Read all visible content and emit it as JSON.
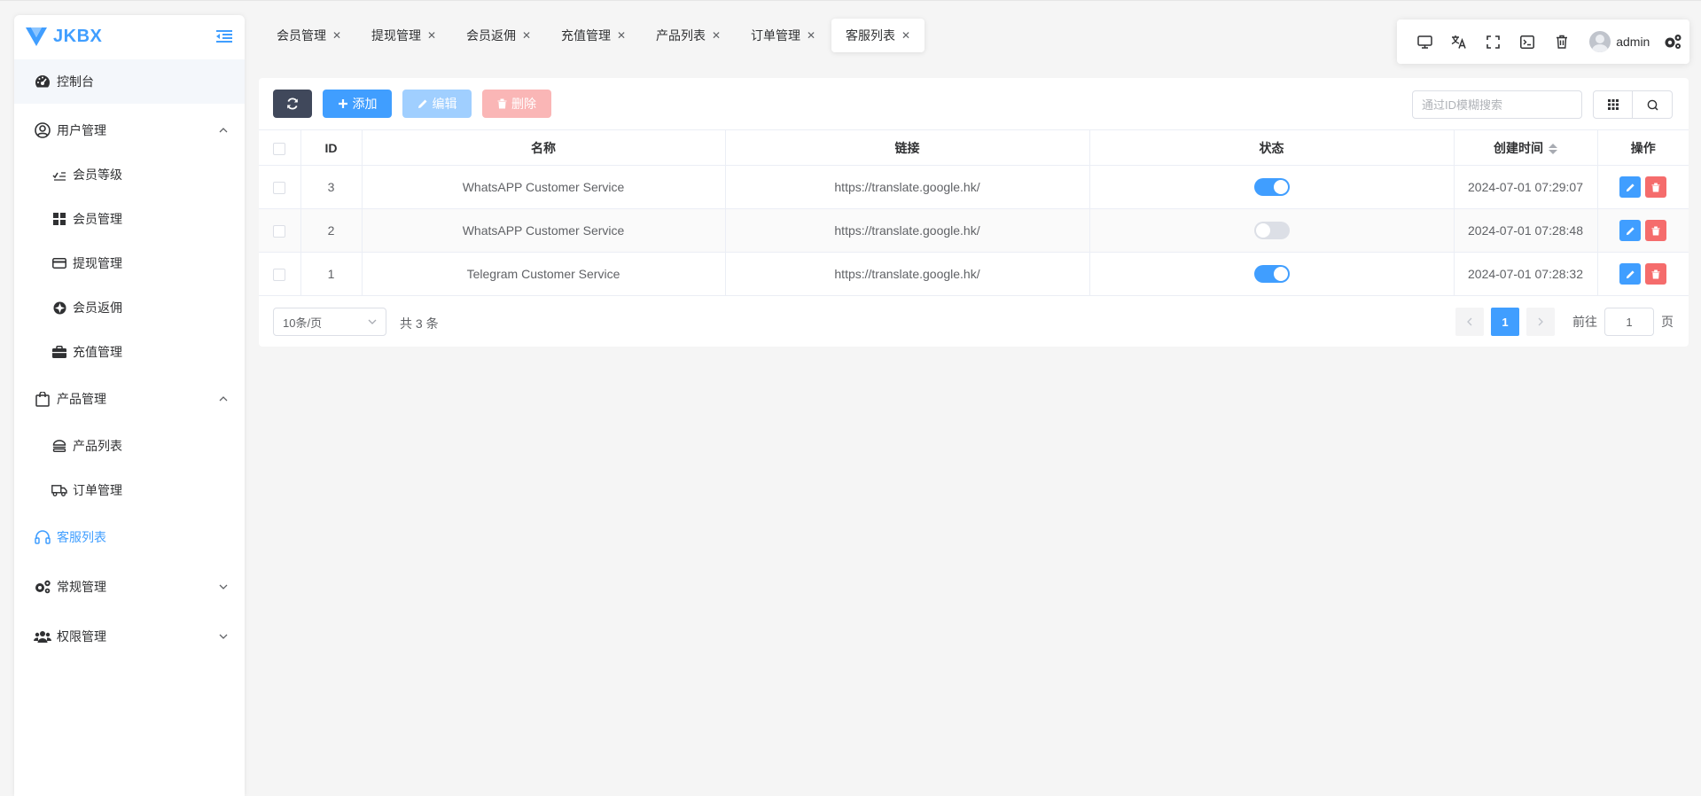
{
  "app": {
    "logo_text": "JKBX"
  },
  "sidebar": {
    "dashboard": "控制台",
    "user_mgmt": "用户管理",
    "user_children": [
      "会员等级",
      "会员管理",
      "提现管理",
      "会员返佣",
      "充值管理"
    ],
    "product_mgmt": "产品管理",
    "product_children": [
      "产品列表",
      "订单管理"
    ],
    "customer_service": "客服列表",
    "general_mgmt": "常规管理",
    "permission_mgmt": "权限管理"
  },
  "tabs": [
    "会员管理",
    "提现管理",
    "会员返佣",
    "充值管理",
    "产品列表",
    "订单管理",
    "客服列表"
  ],
  "active_tab": "客服列表",
  "header": {
    "username": "admin"
  },
  "toolbar": {
    "add_label": "添加",
    "edit_label": "编辑",
    "delete_label": "删除",
    "search_placeholder": "通过ID模糊搜索"
  },
  "table": {
    "columns": [
      "ID",
      "名称",
      "链接",
      "状态",
      "创建时间",
      "操作"
    ],
    "rows": [
      {
        "id": "3",
        "name": "WhatsAPP Customer Service",
        "link": "https://translate.google.hk/",
        "status": true,
        "created": "2024-07-01 07:29:07"
      },
      {
        "id": "2",
        "name": "WhatsAPP Customer Service",
        "link": "https://translate.google.hk/",
        "status": false,
        "created": "2024-07-01 07:28:48"
      },
      {
        "id": "1",
        "name": "Telegram Customer Service",
        "link": "https://translate.google.hk/",
        "status": true,
        "created": "2024-07-01 07:28:32"
      }
    ]
  },
  "pagination": {
    "page_size": "10条/页",
    "total_text": "共 3 条",
    "current_page": "1",
    "goto_label": "前往",
    "goto_value": "1",
    "goto_unit": "页"
  },
  "colors": {
    "primary": "#409eff",
    "danger": "#f56c6c",
    "dark": "#40485b"
  }
}
